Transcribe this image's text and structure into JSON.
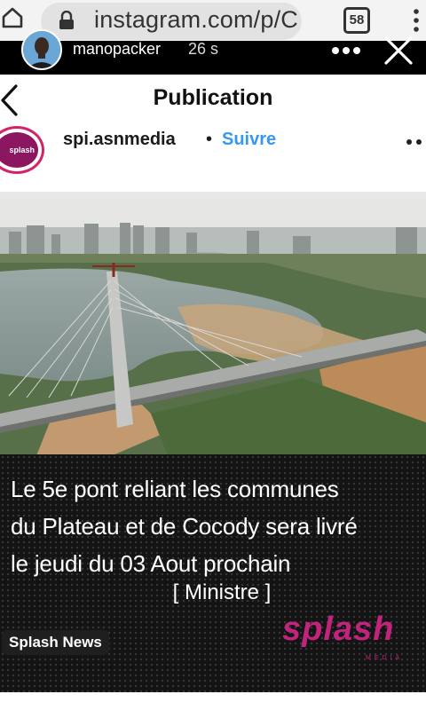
{
  "browser": {
    "url": "instagram.com/p/C",
    "tab_count": "58",
    "icons": [
      "home-icon",
      "lock-icon",
      "tabs-icon",
      "menu-icon"
    ]
  },
  "story": {
    "username": "manopacker",
    "time_ago": "26 s"
  },
  "header": {
    "title": "Publication"
  },
  "post": {
    "account": "spi.asnmedia",
    "separator": "•",
    "follow_label": "Suivre",
    "avatar_text": "splash",
    "image_caption": {
      "headline_lines": [
        "Le 5e pont reliant les communes",
        "du Plateau et de Cocody sera  livré",
        "le jeudi du 03 Aout prochain"
      ],
      "source": "[ Ministre ]",
      "badge": "Splash News",
      "logo": "splash",
      "logo_sub": "MEDIA"
    }
  },
  "colors": {
    "accent_blue": "#3897f0",
    "brand_magenta": "#c2237c"
  }
}
